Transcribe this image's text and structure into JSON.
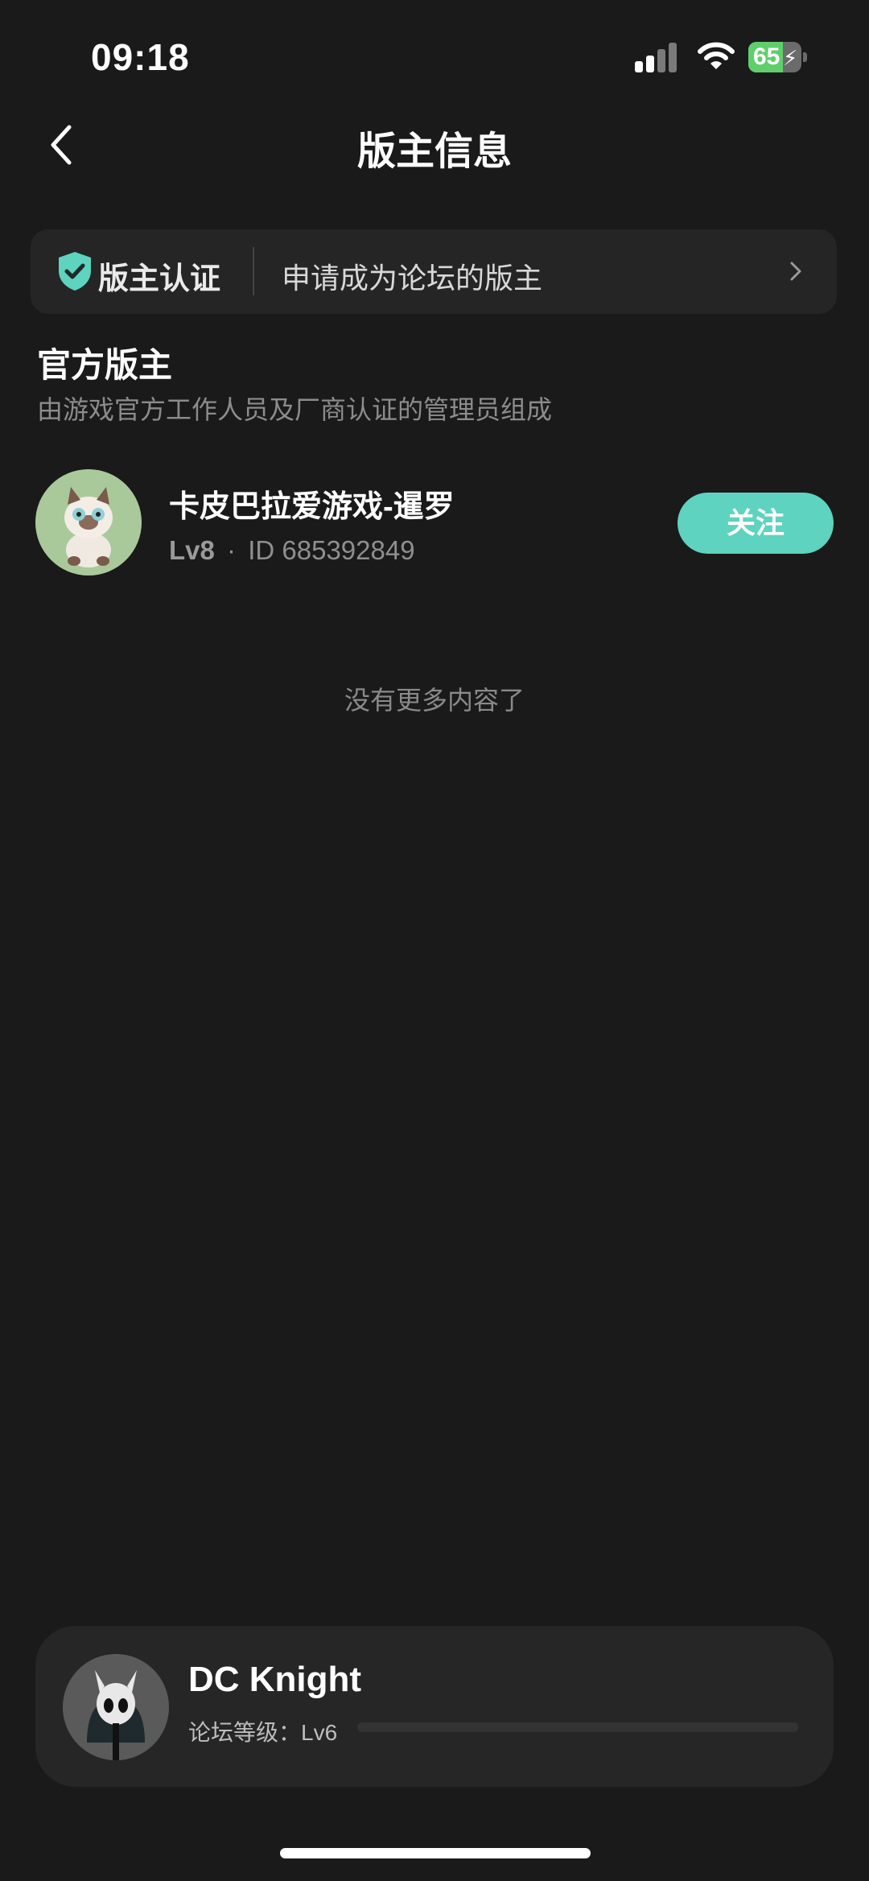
{
  "status_bar": {
    "time": "09:18",
    "battery": "65",
    "battery_fraction": 0.65
  },
  "nav": {
    "title": "版主信息"
  },
  "cert_bar": {
    "label": "版主认证",
    "apply_text": "申请成为论坛的版主"
  },
  "section": {
    "title": "官方版主",
    "subtitle": "由游戏官方工作人员及厂商认证的管理员组成"
  },
  "moderators": [
    {
      "name": "卡皮巴拉爱游戏-暹罗",
      "level": "Lv8",
      "separator": "·",
      "id_text": "ID 685392849",
      "follow_label": "关注"
    }
  ],
  "list_end_text": "没有更多内容了",
  "user_card": {
    "name": "DC Knight",
    "level_label": "论坛等级：Lv6",
    "level_progress": 0.0
  },
  "colors": {
    "accent": "#5ed3bf",
    "background": "#1a1a1a",
    "card": "#262626",
    "battery_green": "#5fcf6a"
  },
  "icons": {
    "back": "chevron-left-icon",
    "shield": "shield-check-icon",
    "chevron": "chevron-right-icon",
    "signal": "signal-icon",
    "wifi": "wifi-icon",
    "battery": "battery-icon"
  }
}
